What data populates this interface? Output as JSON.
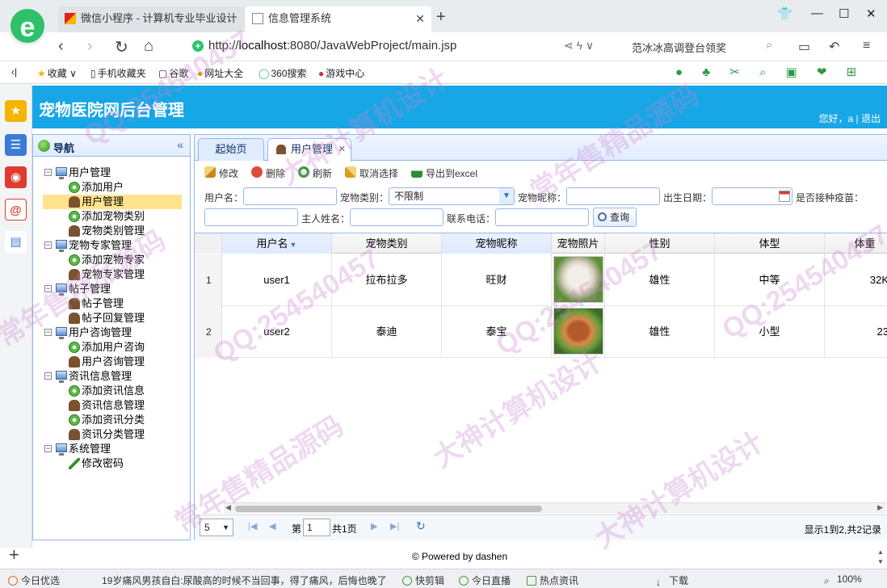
{
  "browser": {
    "tabs": [
      {
        "label": "微信小程序 - 计算机专业毕业设计"
      },
      {
        "label": "信息管理系统"
      }
    ],
    "url_prefix": "http://",
    "url_host": "localhost",
    "url_rest": ":8080/JavaWebProject/main.jsp",
    "search_hint": "范冰冰高调登台领奖",
    "bookmarks": [
      "收藏",
      "手机收藏夹",
      "谷歌",
      "网址大全",
      "360搜索",
      "游戏中心"
    ]
  },
  "app": {
    "title": "宠物医院网后台管理",
    "greeting": "您好，a",
    "logout": "退出"
  },
  "nav": {
    "title": "导航",
    "groups": [
      {
        "label": "用户管理",
        "items": [
          "添加用户",
          "用户管理"
        ]
      },
      {
        "label": "",
        "items": [
          "添加宠物类别",
          "宠物类别管理"
        ]
      },
      {
        "label": "宠物专家管理",
        "items": [
          "添加宠物专家",
          "宠物专家管理"
        ]
      },
      {
        "label": "帖子管理",
        "items": [
          "帖子管理",
          "帖子回复管理"
        ]
      },
      {
        "label": "用户咨询管理",
        "items": [
          "添加用户咨询",
          "用户咨询管理"
        ]
      },
      {
        "label": "资讯信息管理",
        "items": [
          "添加资讯信息",
          "资讯信息管理",
          "添加资讯分类",
          "资讯分类管理"
        ]
      },
      {
        "label": "系统管理",
        "items": [
          "修改密码"
        ]
      }
    ]
  },
  "tabs": {
    "home": "起始页",
    "active": "用户管理"
  },
  "toolbar": {
    "edit": "修改",
    "delete": "删除",
    "refresh": "刷新",
    "cancel_select": "取消选择",
    "export": "导出到excel"
  },
  "filters": {
    "username_label": "用户名：",
    "pet_type_label": "宠物类别：",
    "pet_type_value": "不限制",
    "nickname_label": "宠物昵称：",
    "birthday_label": "出生日期：",
    "vaccinated_label": "是否接种疫苗：",
    "owner_label": "主人姓名：",
    "phone_label": "联系电话：",
    "query_button": "查询"
  },
  "grid": {
    "columns": [
      "用户名",
      "宠物类别",
      "宠物昵称",
      "宠物照片",
      "性别",
      "体型",
      "体重"
    ],
    "rows": [
      {
        "num": "1",
        "username": "user1",
        "pet_type": "拉布拉多",
        "nickname": "旺财",
        "gender": "雄性",
        "size": "中等",
        "weight": "32K"
      },
      {
        "num": "2",
        "username": "user2",
        "pet_type": "泰迪",
        "nickname": "泰宝",
        "gender": "雄性",
        "size": "小型",
        "weight": "23"
      }
    ]
  },
  "pager": {
    "page_size": "5",
    "page_prefix": "第",
    "page_value": "1",
    "page_total": "共1页",
    "info": "显示1到2,共2记录"
  },
  "footer": {
    "text": "© Powered by dashen"
  },
  "statusbar": {
    "items": [
      "今日优选",
      "19岁痛风男孩自白:尿酸高的时候不当回事，得了痛风，后悔也晚了",
      "快剪辑",
      "今日直播",
      "热点资讯",
      "下载",
      "100%"
    ]
  },
  "watermark": {
    "lines": [
      "QQ:254540457",
      "大神计算机设计",
      "常年售精品源码"
    ]
  }
}
